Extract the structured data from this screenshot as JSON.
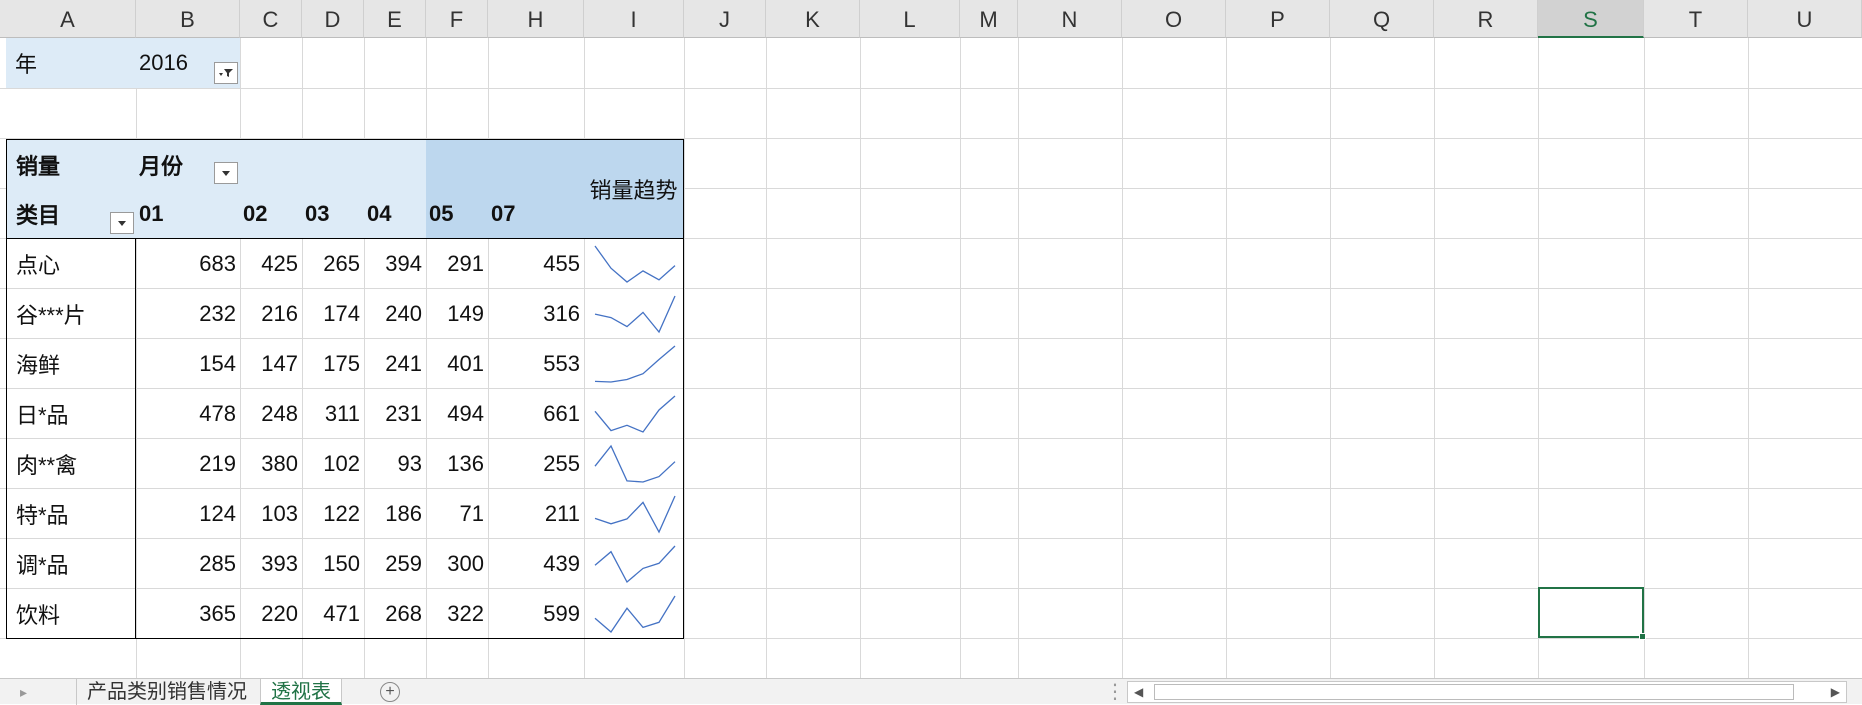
{
  "columns": [
    "A",
    "B",
    "C",
    "D",
    "E",
    "F",
    "H",
    "I",
    "J",
    "K",
    "L",
    "M",
    "N",
    "O",
    "P",
    "Q",
    "R",
    "S",
    "T",
    "U"
  ],
  "selected_column": "S",
  "pivot": {
    "filter_label": "年",
    "filter_value": "2016",
    "value_label": "销量",
    "column_field": "月份",
    "row_field": "类目",
    "sparkline_header": "销量趋势",
    "months": [
      "01",
      "02",
      "03",
      "04",
      "05",
      "07"
    ],
    "rows": [
      {
        "category": "点心",
        "values": [
          683,
          425,
          265,
          394,
          291,
          455
        ]
      },
      {
        "category": "谷***片",
        "values": [
          232,
          216,
          174,
          240,
          149,
          316
        ]
      },
      {
        "category": "海鲜",
        "values": [
          154,
          147,
          175,
          241,
          401,
          553
        ]
      },
      {
        "category": "日*品",
        "values": [
          478,
          248,
          311,
          231,
          494,
          661
        ]
      },
      {
        "category": "肉**禽",
        "values": [
          219,
          380,
          102,
          93,
          136,
          255
        ]
      },
      {
        "category": "特*品",
        "values": [
          124,
          103,
          122,
          186,
          71,
          211
        ]
      },
      {
        "category": "调*品",
        "values": [
          285,
          393,
          150,
          259,
          300,
          439
        ]
      },
      {
        "category": "饮料",
        "values": [
          365,
          220,
          471,
          268,
          322,
          599
        ]
      }
    ]
  },
  "sheet_tabs": [
    "产品类别销售情况",
    "透视表"
  ],
  "active_tab": "透视表",
  "colors": {
    "accent": "#217346",
    "pivot_light": "#ddebf7",
    "pivot_dark": "#bdd7ee",
    "sparkline": "#4472c4"
  }
}
